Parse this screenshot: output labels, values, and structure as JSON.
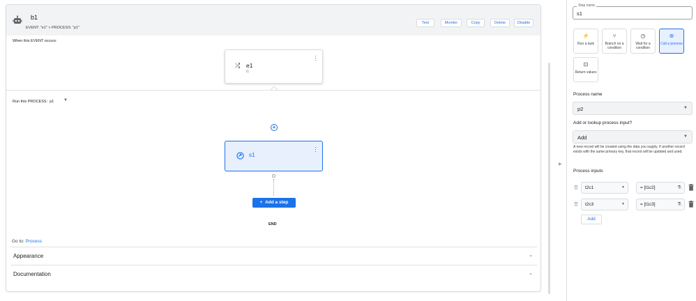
{
  "header": {
    "title": "b1",
    "subtitle": "EVENT: \"e1\" > PROCESS: \"p1\"",
    "buttons": [
      "Test",
      "Monitor",
      "Copy",
      "Delete",
      "Disable"
    ]
  },
  "event_section": {
    "label": "When this EVENT occurs:",
    "event_name": "e1",
    "event_sub": "t1"
  },
  "process_section": {
    "label": "Run this PROCESS:",
    "process_value": "p1",
    "step_name": "s1",
    "add_step_label": "Add a step",
    "end_label": "END"
  },
  "goto": {
    "prefix": "Go to:",
    "link": "Process"
  },
  "sections": [
    "Appearance",
    "Documentation"
  ],
  "right_panel": {
    "step_name_label": "Step name",
    "step_name_value": "s1",
    "step_types": [
      {
        "icon": "lightning-icon",
        "label": "Run a task"
      },
      {
        "icon": "branch-icon",
        "label": "Branch on a condition"
      },
      {
        "icon": "clock-icon",
        "label": "Wait for a condition"
      },
      {
        "icon": "call-process-icon",
        "label": "Call a process",
        "selected": true
      },
      {
        "icon": "return-icon",
        "label": "Return values"
      }
    ],
    "process_name_label": "Process name",
    "process_name_value": "p2",
    "lookup_label": "Add or lookup process input?",
    "lookup_value": "Add",
    "help_text": "A new record will be created using the data you supply. If another record exists with the same primary key, that record will be updated and used.",
    "inputs_label": "Process inputs",
    "inputs": [
      {
        "column": "t2c1",
        "expression": "= [t1c2]"
      },
      {
        "column": "t2c3",
        "expression": "= [t1c3]"
      }
    ],
    "add_label": "Add"
  },
  "colors": {
    "accent": "#1a73e8",
    "header_bg": "#f1f3f4",
    "selected_bg": "#e8f0fe"
  }
}
